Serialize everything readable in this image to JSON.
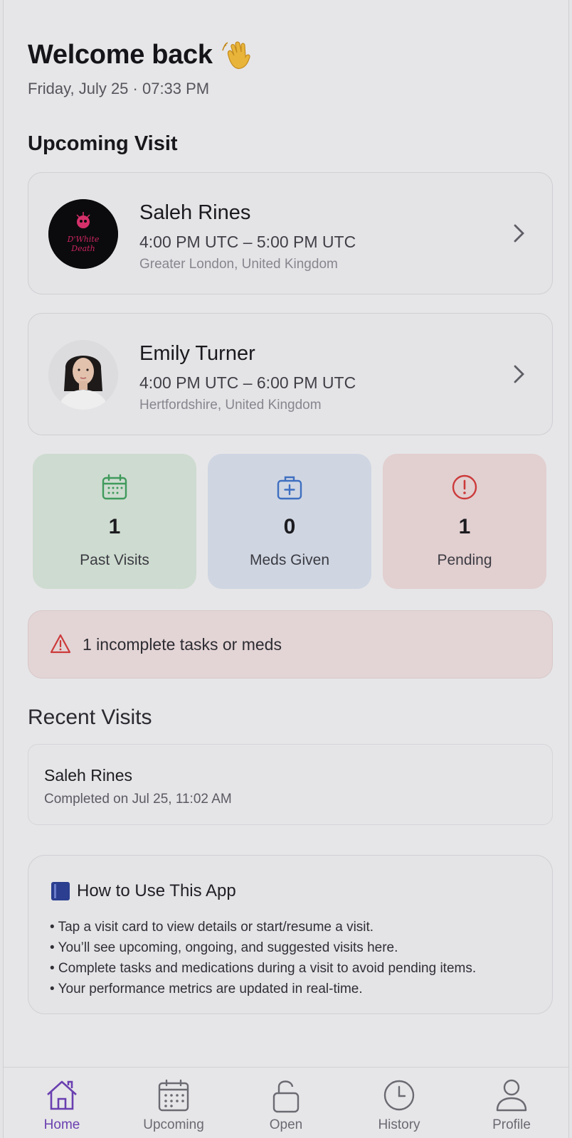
{
  "header": {
    "title": "Welcome back",
    "wave_emoji": "👋",
    "date_time": "Friday, July 25 · 07:33 PM"
  },
  "upcoming": {
    "section_title": "Upcoming Visit",
    "visits": [
      {
        "name": "Saleh Rines",
        "time": "4:00 PM UTC – 5:00 PM UTC",
        "location": "Greater London, United Kingdom",
        "avatar_text": "D'White Death"
      },
      {
        "name": "Emily Turner",
        "time": "4:00 PM UTC – 6:00 PM UTC",
        "location": "Hertfordshire, United Kingdom"
      }
    ]
  },
  "stats": [
    {
      "value": "1",
      "label": "Past Visits",
      "icon": "calendar-icon",
      "bg": "#cfdccf",
      "accent": "#3f9a5c"
    },
    {
      "value": "0",
      "label": "Meds Given",
      "icon": "medkit-icon",
      "bg": "#cfd6e1",
      "accent": "#3f6fc0"
    },
    {
      "value": "1",
      "label": "Pending",
      "icon": "alert-circle-icon",
      "bg": "#e2cfd0",
      "accent": "#cc3a3a"
    }
  ],
  "alert": {
    "text": "1 incomplete tasks or meds",
    "icon": "warning-triangle-icon",
    "color": "#cc3a3a"
  },
  "recent": {
    "section_title": "Recent Visits",
    "items": [
      {
        "name": "Saleh Rines",
        "subtitle": "Completed on Jul 25, 11:02 AM"
      }
    ]
  },
  "howto": {
    "title": "How to Use This App",
    "icon": "book-icon",
    "items": [
      "• Tap a visit card to view details or start/resume a visit.",
      "• You’ll see upcoming, ongoing, and suggested visits here.",
      "• Complete tasks and medications during a visit to avoid pending items.",
      "• Your performance metrics are updated in real-time."
    ]
  },
  "tabbar": {
    "tabs": [
      {
        "label": "Home",
        "icon": "home-icon",
        "active": true
      },
      {
        "label": "Upcoming",
        "icon": "calendar-icon",
        "active": false
      },
      {
        "label": "Open",
        "icon": "unlock-icon",
        "active": false
      },
      {
        "label": "History",
        "icon": "clock-icon",
        "active": false
      },
      {
        "label": "Profile",
        "icon": "user-icon",
        "active": false
      }
    ],
    "active_color": "#6a3fb0"
  }
}
